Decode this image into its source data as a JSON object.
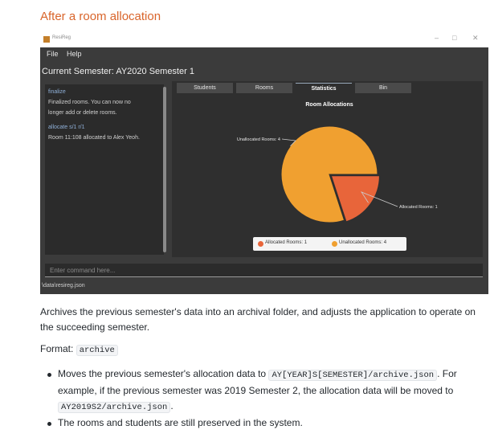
{
  "heading": "After a room allocation",
  "app": {
    "title": "ResiReg",
    "menu": [
      "File",
      "Help"
    ],
    "semester_label": "Current Semester: AY2020 Semester 1",
    "log": [
      {
        "text": "finalize",
        "color": "#8fb0d8"
      },
      {
        "text": "Finalized rooms. You can now no",
        "color": "#d0d0d0"
      },
      {
        "text": "longer add or delete rooms.",
        "color": "#d0d0d0"
      },
      {
        "text": "allocate s/1 r/1",
        "color": "#8fb0d8"
      },
      {
        "text": "Room 11:108 allocated to Alex Yeoh.",
        "color": "#d0d0d0"
      }
    ],
    "tabs": [
      "Students",
      "Rooms",
      "Statistics",
      "Bin"
    ],
    "active_tab": "Statistics",
    "command_placeholder": "Enter command here...",
    "status_path": "\\data\\resireg.json"
  },
  "chart_data": {
    "type": "pie",
    "title": "Room Allocations",
    "slices": [
      {
        "label": "Allocated Rooms",
        "value": 1,
        "color": "#e8653a",
        "callout": "Allocated Rooms: 1"
      },
      {
        "label": "Unallocated Rooms",
        "value": 4,
        "color": "#f0a030",
        "callout": "Unallocated Rooms: 4"
      }
    ],
    "legend": [
      {
        "text": "Allocated Rooms: 1",
        "color": "#e8653a"
      },
      {
        "text": "Unallocated Rooms: 4",
        "color": "#f0a030"
      }
    ],
    "legend_position": "bottom"
  },
  "doc": {
    "description": "Archives the previous semester's data into an archival folder, and adjusts the application to operate on the succeeding semester.",
    "format_label": "Format:",
    "format_code": "archive",
    "bullet1_text_a": "Moves the previous semester's allocation data to",
    "bullet1_code_a": "AY[YEAR]S[SEMESTER]/archive.json",
    "bullet1_text_b": ". For example, if the previous semester was 2019 Semester 2, the allocation data will be moved to",
    "bullet1_code_b": "AY2019S2/archive.json",
    "bullet1_text_c": ".",
    "bullet2": "The rooms and students are still preserved in the system."
  }
}
